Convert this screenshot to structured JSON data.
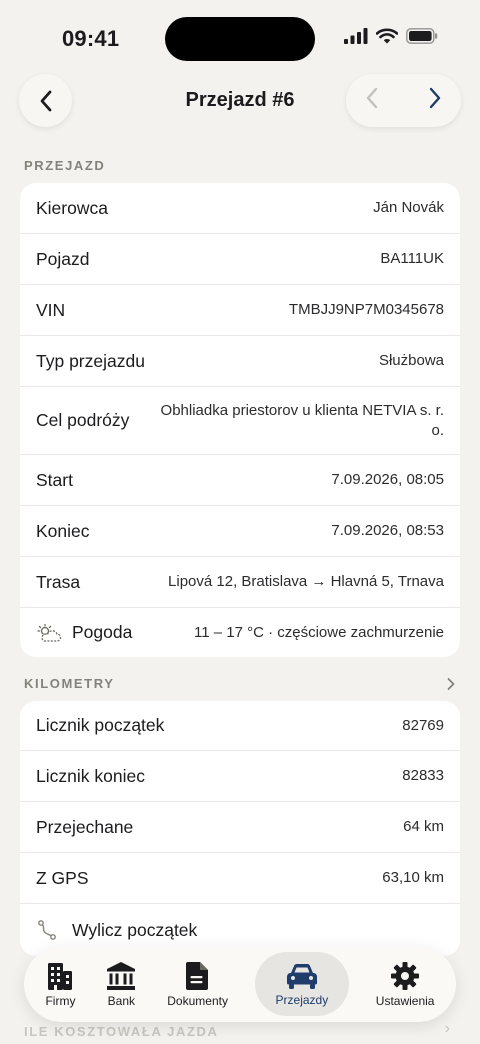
{
  "status": {
    "time": "09:41"
  },
  "nav": {
    "title": "Przejazd #6"
  },
  "trip_section": {
    "header": "PRZEJAZD",
    "rows": [
      {
        "label": "Kierowca",
        "value": "Ján Novák"
      },
      {
        "label": "Pojazd",
        "value": "BA111UK"
      },
      {
        "label": "VIN",
        "value": "TMBJJ9NP7M0345678"
      },
      {
        "label": "Typ przejazdu",
        "value": "Służbowa"
      },
      {
        "label": "Cel podróży",
        "value": "Obhliadka priestorov u klienta NETVIA s. r. o."
      },
      {
        "label": "Start",
        "value": "7.09.2026, 08:05"
      },
      {
        "label": "Koniec",
        "value": "7.09.2026, 08:53"
      },
      {
        "label": "Trasa",
        "value": "Lipová 12, Bratislava → Hlavná 5, Trnava"
      },
      {
        "label": "Pogoda",
        "value": "11 – 17 °C · częściowe zachmurzenie",
        "icon": "cloud-sun-icon"
      }
    ]
  },
  "km_section": {
    "header": "KILOMETRY",
    "rows": [
      {
        "label": "Licznik początek",
        "value": "82769"
      },
      {
        "label": "Licznik koniec",
        "value": "82833"
      },
      {
        "label": "Przejechane",
        "value": "64 km"
      },
      {
        "label": "Z GPS",
        "value": "63,10 km"
      }
    ],
    "action": {
      "label": "Wylicz początek",
      "icon": "route-icon"
    }
  },
  "cost_section": {
    "header": "ILE KOSZTOWAŁA JAZDA"
  },
  "tabs": [
    {
      "label": "Firmy",
      "icon": "building-icon"
    },
    {
      "label": "Bank",
      "icon": "bank-icon"
    },
    {
      "label": "Dokumenty",
      "icon": "document-icon"
    },
    {
      "label": "Przejazdy",
      "icon": "car-icon",
      "active": true
    },
    {
      "label": "Ustawienia",
      "icon": "gear-icon"
    }
  ],
  "colors": {
    "background": "#f3f2ef",
    "card": "#ffffff",
    "accent": "#1f3c6b",
    "section_header": "#85827c"
  }
}
